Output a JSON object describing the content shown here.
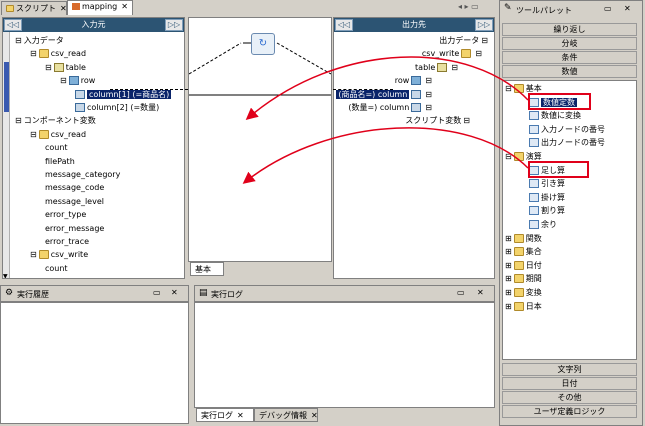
{
  "editor_tabs": [
    {
      "label": "スクリプト",
      "active": false
    },
    {
      "label": "mapping",
      "active": true
    }
  ],
  "input_panel": {
    "header": "入力元",
    "collapse_btn": "◁◁",
    "expand_btn": "▷▷",
    "tree": [
      {
        "label": "入力データ",
        "level": 0,
        "exp": "⊟"
      },
      {
        "label": "csv_read",
        "level": 1,
        "exp": "⊟"
      },
      {
        "label": "table",
        "level": 2,
        "exp": "⊟"
      },
      {
        "label": "row",
        "level": 3,
        "exp": "⊟"
      },
      {
        "label": "column[1] (=商品名)",
        "level": 4,
        "selected": true
      },
      {
        "label": "column[2] (=数量)",
        "level": 4
      },
      {
        "label": "コンポーネント変数",
        "level": 0,
        "exp": "⊟"
      },
      {
        "label": "csv_read",
        "level": 1,
        "exp": "⊟"
      },
      {
        "label": "count",
        "level": 2
      },
      {
        "label": "filePath",
        "level": 2
      },
      {
        "label": "message_category",
        "level": 2
      },
      {
        "label": "message_code",
        "level": 2
      },
      {
        "label": "message_level",
        "level": 2
      },
      {
        "label": "error_type",
        "level": 2
      },
      {
        "label": "error_message",
        "level": 2
      },
      {
        "label": "error_trace",
        "level": 2
      },
      {
        "label": "csv_write",
        "level": 1,
        "exp": "⊟"
      },
      {
        "label": "count",
        "level": 2
      }
    ]
  },
  "center_panel": {
    "bottom_tab": "基本"
  },
  "output_panel": {
    "header": "出力先",
    "collapse_btn": "◁◁",
    "expand_btn": "▷▷",
    "tree": [
      {
        "label": "出力データ"
      },
      {
        "label": "csv_write"
      },
      {
        "label": "table"
      },
      {
        "label": "row"
      },
      {
        "label": "(商品名=) column",
        "selected": true
      },
      {
        "label": "(数量=) column"
      },
      {
        "label": "スクリプト変数"
      }
    ]
  },
  "history_panel": {
    "title": "実行履歴"
  },
  "log_panel": {
    "title": "実行ログ",
    "bottom_tabs": [
      "実行ログ",
      "デバッグ情報"
    ]
  },
  "palette": {
    "title": "ツールパレット",
    "top_buttons": [
      "繰り返し",
      "分岐",
      "条件",
      "数値"
    ],
    "tree": [
      {
        "label": "基本",
        "type": "folder",
        "exp": "⊟"
      },
      {
        "label": "数値定数",
        "type": "item",
        "selected": true
      },
      {
        "label": "数値に変換",
        "type": "item"
      },
      {
        "label": "入力ノードの番号",
        "type": "item"
      },
      {
        "label": "出力ノードの番号",
        "type": "item"
      },
      {
        "label": "演算",
        "type": "folder",
        "exp": "⊟"
      },
      {
        "label": "足し算",
        "type": "item"
      },
      {
        "label": "引き算",
        "type": "item"
      },
      {
        "label": "掛け算",
        "type": "item"
      },
      {
        "label": "割り算",
        "type": "item"
      },
      {
        "label": "余り",
        "type": "item"
      },
      {
        "label": "関数",
        "type": "folder",
        "exp": "⊞"
      },
      {
        "label": "集合",
        "type": "folder",
        "exp": "⊞"
      },
      {
        "label": "日付",
        "type": "folder",
        "exp": "⊞"
      },
      {
        "label": "期間",
        "type": "folder",
        "exp": "⊞"
      },
      {
        "label": "変換",
        "type": "folder",
        "exp": "⊞"
      },
      {
        "label": "日本",
        "type": "folder",
        "exp": "⊞"
      }
    ],
    "bottom_buttons": [
      "文字列",
      "日付",
      "その他",
      "ユーザ定義ロジック"
    ]
  },
  "colors": {
    "header": "#2c5473",
    "selection": "#0a246a",
    "annotation": "#e0001a"
  }
}
